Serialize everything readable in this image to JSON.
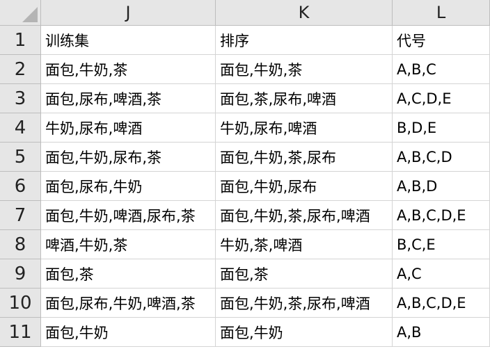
{
  "columns": [
    "J",
    "K",
    "L"
  ],
  "rows": [
    {
      "num": "1",
      "cells": [
        "训练集",
        "排序",
        "代号"
      ]
    },
    {
      "num": "2",
      "cells": [
        "面包,牛奶,茶",
        "面包,牛奶,茶",
        "A,B,C"
      ]
    },
    {
      "num": "3",
      "cells": [
        "面包,尿布,啤酒,茶",
        "面包,茶,尿布,啤酒",
        "A,C,D,E"
      ]
    },
    {
      "num": "4",
      "cells": [
        "牛奶,尿布,啤酒",
        "牛奶,尿布,啤酒",
        "B,D,E"
      ]
    },
    {
      "num": "5",
      "cells": [
        "面包,牛奶,尿布,茶",
        "面包,牛奶,茶,尿布",
        "A,B,C,D"
      ]
    },
    {
      "num": "6",
      "cells": [
        "面包,尿布,牛奶",
        "面包,牛奶,尿布",
        "A,B,D"
      ]
    },
    {
      "num": "7",
      "cells": [
        "面包,牛奶,啤酒,尿布,茶",
        "面包,牛奶,茶,尿布,啤酒",
        "A,B,C,D,E"
      ]
    },
    {
      "num": "8",
      "cells": [
        "啤酒,牛奶,茶",
        "牛奶,茶,啤酒",
        "B,C,E"
      ]
    },
    {
      "num": "9",
      "cells": [
        "面包,茶",
        "面包,茶",
        "A,C"
      ]
    },
    {
      "num": "10",
      "cells": [
        "面包,尿布,牛奶,啤酒,茶",
        "面包,牛奶,茶,尿布,啤酒",
        "A,B,C,D,E"
      ]
    },
    {
      "num": "11",
      "cells": [
        "面包,牛奶",
        "面包,牛奶",
        "A,B"
      ]
    }
  ]
}
